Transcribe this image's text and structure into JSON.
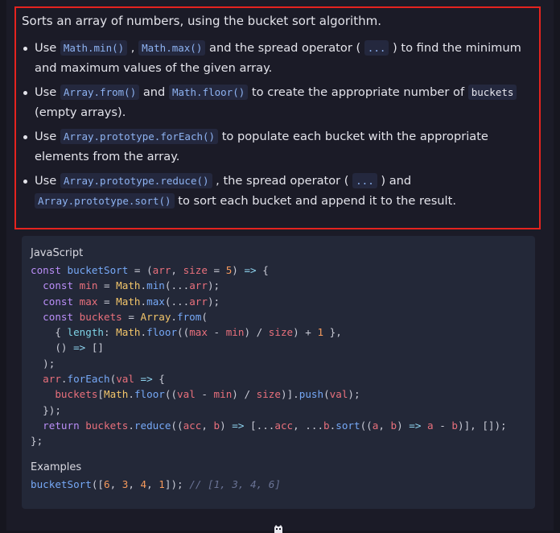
{
  "description": {
    "intro": "Sorts an array of numbers, using the bucket sort algorithm.",
    "items": [
      [
        {
          "t": "text",
          "v": "Use "
        },
        {
          "t": "code",
          "v": "Math.min()"
        },
        {
          "t": "text",
          "v": " , "
        },
        {
          "t": "code",
          "v": "Math.max()"
        },
        {
          "t": "text",
          "v": " and the spread operator ( "
        },
        {
          "t": "code",
          "v": "..."
        },
        {
          "t": "text",
          "v": " ) to find the minimum and maximum values of the given array."
        }
      ],
      [
        {
          "t": "text",
          "v": "Use "
        },
        {
          "t": "code",
          "v": "Array.from()"
        },
        {
          "t": "text",
          "v": " and "
        },
        {
          "t": "code",
          "v": "Math.floor()"
        },
        {
          "t": "text",
          "v": " to create the appropriate number of "
        },
        {
          "t": "plaincode",
          "v": "buckets"
        },
        {
          "t": "text",
          "v": " (empty arrays)."
        }
      ],
      [
        {
          "t": "text",
          "v": "Use "
        },
        {
          "t": "code",
          "v": "Array.prototype.forEach()"
        },
        {
          "t": "text",
          "v": " to populate each bucket with the appropriate elements from the array."
        }
      ],
      [
        {
          "t": "text",
          "v": "Use "
        },
        {
          "t": "code",
          "v": "Array.prototype.reduce()"
        },
        {
          "t": "text",
          "v": " , the spread operator ( "
        },
        {
          "t": "code",
          "v": "..."
        },
        {
          "t": "text",
          "v": " ) and "
        },
        {
          "t": "code",
          "v": "Array.prototype.sort()"
        },
        {
          "t": "text",
          "v": " to sort each bucket and append it to the result."
        }
      ]
    ]
  },
  "code_block": {
    "language": "JavaScript",
    "lines": [
      [
        [
          "kw",
          "const "
        ],
        [
          "fn",
          "bucketSort"
        ],
        [
          "p",
          " = ("
        ],
        [
          "var",
          "arr"
        ],
        [
          "p",
          ", "
        ],
        [
          "var",
          "size"
        ],
        [
          "p",
          " = "
        ],
        [
          "num",
          "5"
        ],
        [
          "p",
          ") "
        ],
        [
          "op",
          "=>"
        ],
        [
          "p",
          " {"
        ]
      ],
      [
        [
          "p",
          "  "
        ],
        [
          "kw",
          "const "
        ],
        [
          "var",
          "min"
        ],
        [
          "p",
          " = "
        ],
        [
          "obj",
          "Math"
        ],
        [
          "p",
          "."
        ],
        [
          "fn",
          "min"
        ],
        [
          "p",
          "(..."
        ],
        [
          "var",
          "arr"
        ],
        [
          "p",
          ");"
        ]
      ],
      [
        [
          "p",
          "  "
        ],
        [
          "kw",
          "const "
        ],
        [
          "var",
          "max"
        ],
        [
          "p",
          " = "
        ],
        [
          "obj",
          "Math"
        ],
        [
          "p",
          "."
        ],
        [
          "fn",
          "max"
        ],
        [
          "p",
          "(..."
        ],
        [
          "var",
          "arr"
        ],
        [
          "p",
          ");"
        ]
      ],
      [
        [
          "p",
          "  "
        ],
        [
          "kw",
          "const "
        ],
        [
          "var",
          "buckets"
        ],
        [
          "p",
          " = "
        ],
        [
          "obj",
          "Array"
        ],
        [
          "p",
          "."
        ],
        [
          "fn",
          "from"
        ],
        [
          "p",
          "("
        ]
      ],
      [
        [
          "p",
          "    { "
        ],
        [
          "prop",
          "length"
        ],
        [
          "p",
          ": "
        ],
        [
          "obj",
          "Math"
        ],
        [
          "p",
          "."
        ],
        [
          "fn",
          "floor"
        ],
        [
          "p",
          "(("
        ],
        [
          "var",
          "max"
        ],
        [
          "p",
          " - "
        ],
        [
          "var",
          "min"
        ],
        [
          "p",
          ") / "
        ],
        [
          "var",
          "size"
        ],
        [
          "p",
          ") + "
        ],
        [
          "num",
          "1"
        ],
        [
          "p",
          " },"
        ]
      ],
      [
        [
          "p",
          "    () "
        ],
        [
          "op",
          "=>"
        ],
        [
          "p",
          " []"
        ]
      ],
      [
        [
          "p",
          "  );"
        ]
      ],
      [
        [
          "p",
          "  "
        ],
        [
          "var",
          "arr"
        ],
        [
          "p",
          "."
        ],
        [
          "fn",
          "forEach"
        ],
        [
          "p",
          "("
        ],
        [
          "var",
          "val"
        ],
        [
          "p",
          " "
        ],
        [
          "op",
          "=>"
        ],
        [
          "p",
          " {"
        ]
      ],
      [
        [
          "p",
          "    "
        ],
        [
          "var",
          "buckets"
        ],
        [
          "p",
          "["
        ],
        [
          "obj",
          "Math"
        ],
        [
          "p",
          "."
        ],
        [
          "fn",
          "floor"
        ],
        [
          "p",
          "(("
        ],
        [
          "var",
          "val"
        ],
        [
          "p",
          " - "
        ],
        [
          "var",
          "min"
        ],
        [
          "p",
          ") / "
        ],
        [
          "var",
          "size"
        ],
        [
          "p",
          ")]."
        ],
        [
          "fn",
          "push"
        ],
        [
          "p",
          "("
        ],
        [
          "var",
          "val"
        ],
        [
          "p",
          ");"
        ]
      ],
      [
        [
          "p",
          "  });"
        ]
      ],
      [
        [
          "p",
          "  "
        ],
        [
          "kw",
          "return "
        ],
        [
          "var",
          "buckets"
        ],
        [
          "p",
          "."
        ],
        [
          "fn",
          "reduce"
        ],
        [
          "p",
          "(("
        ],
        [
          "var",
          "acc"
        ],
        [
          "p",
          ", "
        ],
        [
          "var",
          "b"
        ],
        [
          "p",
          ") "
        ],
        [
          "op",
          "=>"
        ],
        [
          "p",
          " [..."
        ],
        [
          "var",
          "acc"
        ],
        [
          "p",
          ", ..."
        ],
        [
          "var",
          "b"
        ],
        [
          "p",
          "."
        ],
        [
          "fn",
          "sort"
        ],
        [
          "p",
          "(("
        ],
        [
          "var",
          "a"
        ],
        [
          "p",
          ", "
        ],
        [
          "var",
          "b"
        ],
        [
          "p",
          ") "
        ],
        [
          "op",
          "=>"
        ],
        [
          "p",
          " "
        ],
        [
          "var",
          "a"
        ],
        [
          "p",
          " - "
        ],
        [
          "var",
          "b"
        ],
        [
          "p",
          ")], []);"
        ]
      ],
      [
        [
          "p",
          "};"
        ]
      ]
    ]
  },
  "examples_block": {
    "label": "Examples",
    "lines": [
      [
        [
          "fn",
          "bucketSort"
        ],
        [
          "p",
          "(["
        ],
        [
          "num",
          "6"
        ],
        [
          "p",
          ", "
        ],
        [
          "num",
          "3"
        ],
        [
          "p",
          ", "
        ],
        [
          "num",
          "4"
        ],
        [
          "p",
          ", "
        ],
        [
          "num",
          "1"
        ],
        [
          "p",
          "]); "
        ],
        [
          "cm",
          "// [1, 3, 4, 6]"
        ]
      ]
    ]
  },
  "footer": {
    "icon": "github-icon"
  }
}
